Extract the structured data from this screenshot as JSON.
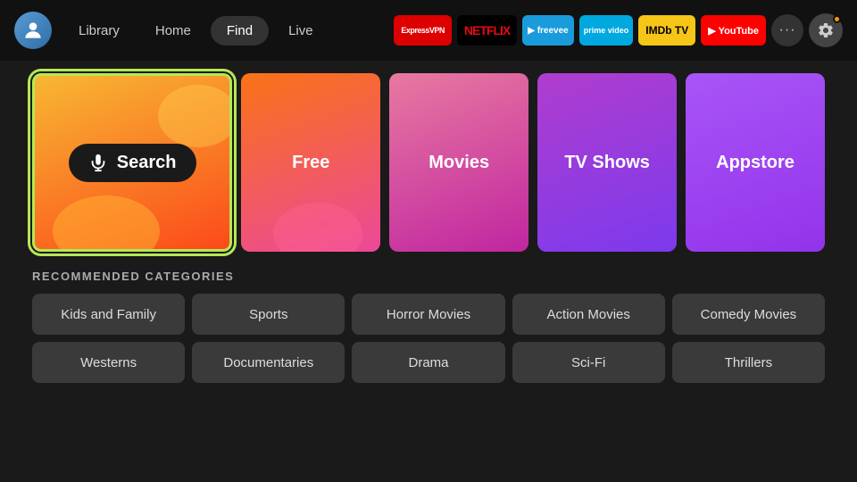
{
  "header": {
    "nav": {
      "library": "Library",
      "home": "Home",
      "find": "Find",
      "live": "Live"
    },
    "apps": [
      {
        "id": "expressvpn",
        "label": "ExpressVPN",
        "class": "badge-express"
      },
      {
        "id": "netflix",
        "label": "NETFLIX",
        "class": "badge-netflix"
      },
      {
        "id": "freevee",
        "label": "▶ freevee",
        "class": "badge-freevee"
      },
      {
        "id": "prime",
        "label": "prime video",
        "class": "badge-prime"
      },
      {
        "id": "imdb",
        "label": "IMDb TV",
        "class": "badge-imdb"
      },
      {
        "id": "youtube",
        "label": "▶ YouTube",
        "class": "badge-youtube"
      }
    ],
    "more_label": "···",
    "settings_label": "⚙"
  },
  "tiles": [
    {
      "id": "search",
      "label": "Search",
      "type": "search"
    },
    {
      "id": "free",
      "label": "Free",
      "type": "regular"
    },
    {
      "id": "movies",
      "label": "Movies",
      "type": "regular"
    },
    {
      "id": "tvshows",
      "label": "TV Shows",
      "type": "regular"
    },
    {
      "id": "appstore",
      "label": "Appstore",
      "type": "regular"
    }
  ],
  "recommended": {
    "title": "RECOMMENDED CATEGORIES",
    "rows": [
      [
        "Kids and Family",
        "Sports",
        "Horror Movies",
        "Action Movies",
        "Comedy Movies"
      ],
      [
        "Westerns",
        "Documentaries",
        "Drama",
        "Sci-Fi",
        "Thrillers"
      ]
    ]
  }
}
